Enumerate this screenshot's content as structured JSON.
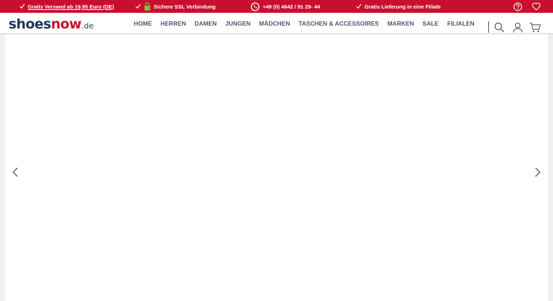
{
  "topbar": {
    "shipping_text": "Gratis Versand ab 19,95 Euro (DE)",
    "ssl_text": "Sichere SSL Verbindung",
    "phone_text": "+49 (0) 4642 / 91 29- 44",
    "store_text": "Gratis Lieferung in eine Filiale",
    "background_color": "#c8102e"
  },
  "logo": {
    "part1": "shoes",
    "part2": "now",
    "part3": ".de"
  },
  "nav": {
    "items": [
      {
        "label": "HOME"
      },
      {
        "label": "HERREN"
      },
      {
        "label": "DAMEN"
      },
      {
        "label": "JUNGEN"
      },
      {
        "label": "MÄDCHEN"
      },
      {
        "label": "TASCHEN & ACCESSOIRES"
      },
      {
        "label": "MARKEN"
      },
      {
        "label": "SALE"
      },
      {
        "label": "FILIALEN"
      }
    ]
  },
  "header_icons": [
    "search-icon",
    "user-icon",
    "cart-icon"
  ],
  "topbar_icons": [
    "help-icon",
    "heart-icon"
  ],
  "slider": {
    "prev_icon": "chevron-left-icon",
    "next_icon": "chevron-right-icon"
  }
}
